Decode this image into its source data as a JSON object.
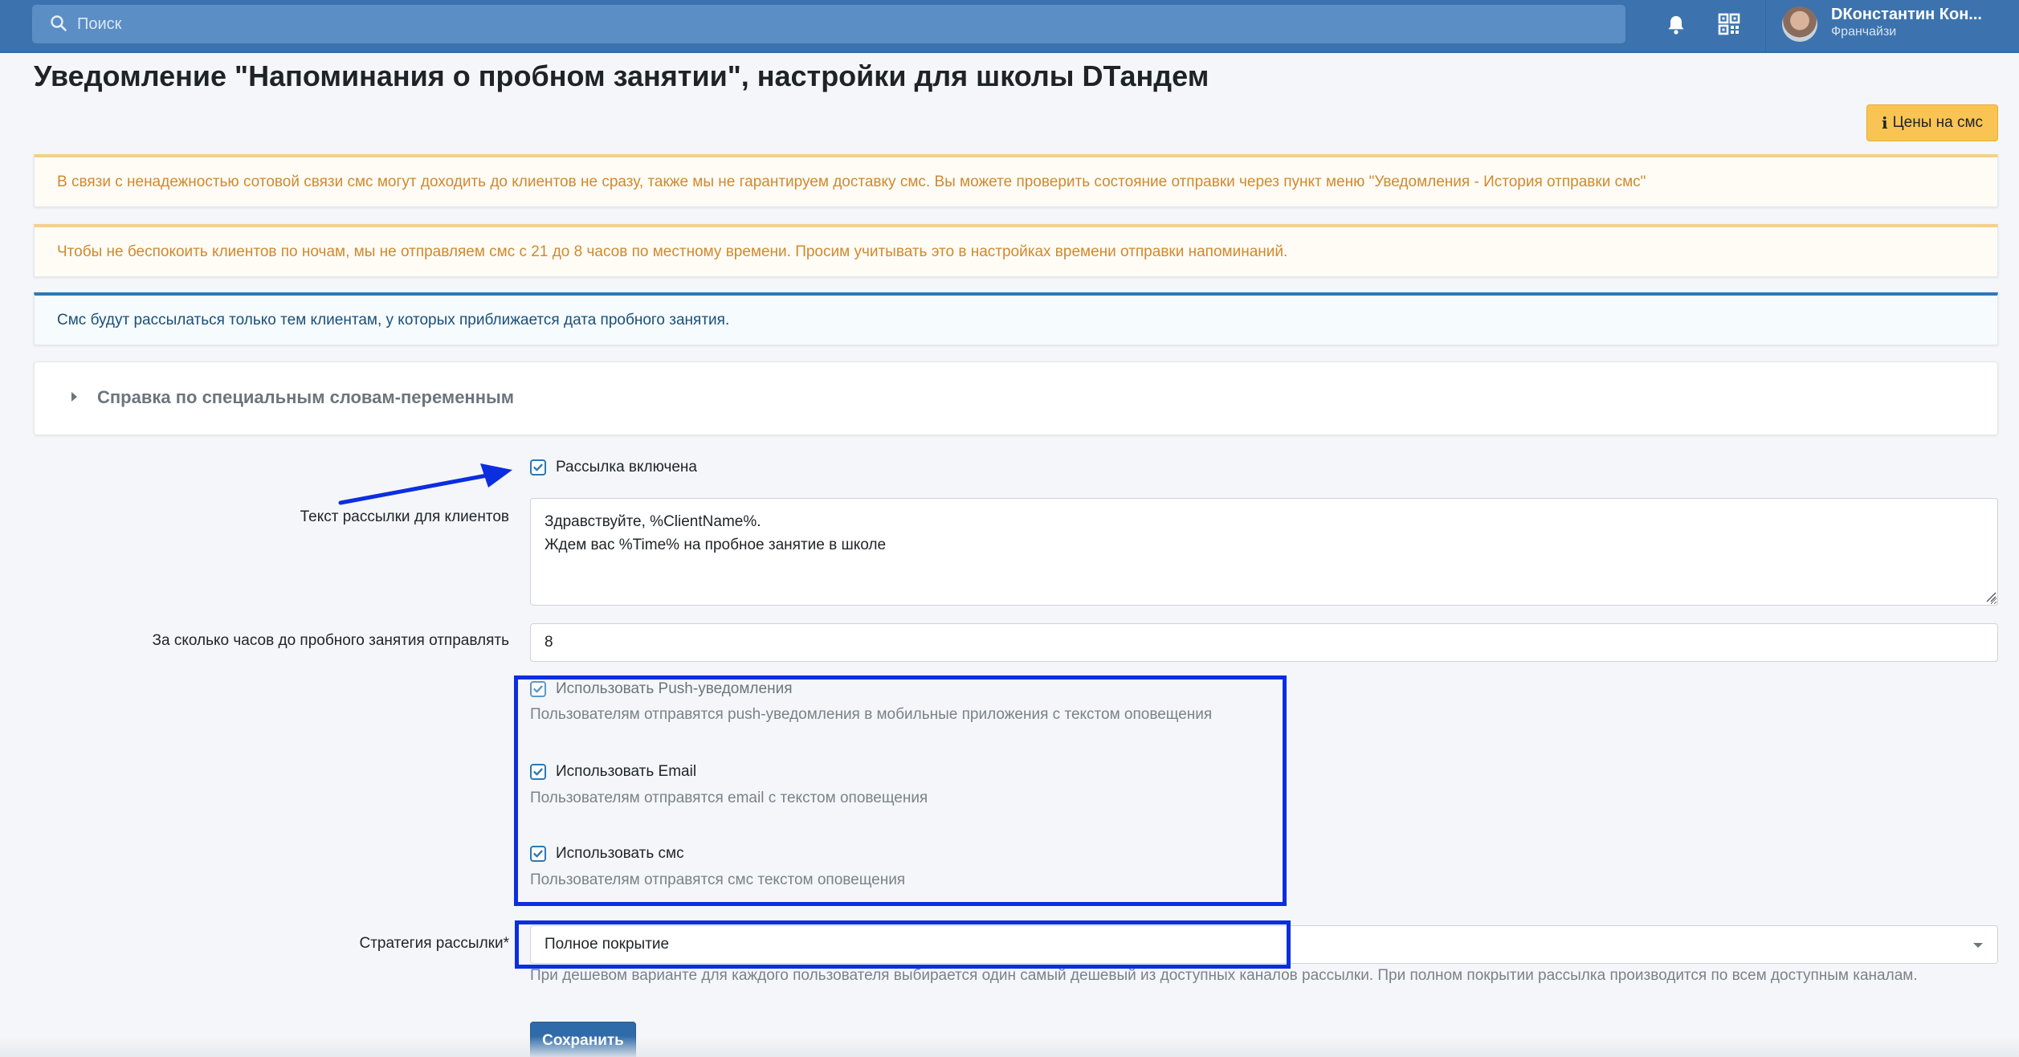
{
  "topbar": {
    "search_placeholder": "Поиск",
    "icons": [
      "search-icon",
      "bell-icon",
      "qr-code-icon"
    ],
    "user_name": "DКонстантин Кон...",
    "user_role": "Франчайзи"
  },
  "page": {
    "title": "Уведомление \"Напоминания о пробном занятии\", настройки для школы DТандем",
    "sms_price_button": "Цены на смс"
  },
  "alerts": [
    "В связи с ненадежностью сотовой связи смс могут доходить до клиентов не сразу, также мы не гарантируем доставку смс. Вы можете проверить состояние отправки через пункт меню \"Уведомления - История отправки смс\"",
    "Чтобы не беспокоить клиентов по ночам, мы не отправляем смс с 21 до 8 часов по местному времени. Просим учитывать это в настройках времени отправки напоминаний.",
    "Смс будут рассылаться только тем клиентам, у которых приближается дата пробного занятия."
  ],
  "help_section": {
    "label": "Справка по специальным словам-переменным",
    "expanded": false
  },
  "form": {
    "mailing_enabled": {
      "label": "Рассылка включена",
      "checked": true
    },
    "message_text": {
      "label": "Текст рассылки для клиентов",
      "value": "Здравствуйте, %ClientName%.\nЖдем вас %Time% на пробное занятие в школе"
    },
    "hours_before": {
      "label": "За сколько часов до пробного занятия отправлять",
      "value": "8"
    },
    "channels": [
      {
        "label": "Использовать Push-уведомления",
        "checked": true,
        "disabled": true,
        "help": "Пользователям отправятся push-уведомления в мобильные приложения с текстом оповещения"
      },
      {
        "label": "Использовать Email",
        "checked": true,
        "disabled": false,
        "help": "Пользователям отправятся email с текстом оповещения"
      },
      {
        "label": "Использовать смс",
        "checked": true,
        "disabled": false,
        "help": "Пользователям отправятся смс текстом оповещения"
      }
    ],
    "strategy": {
      "label": "Стратегия рассылки*",
      "value": "Полное покрытие",
      "help": "При дешевом варианте для каждого пользователя выбирается один самый дешевый из доступных каналов рассылки. При полном покрытии рассылка производится по всем доступным каналам."
    },
    "save_button": "Сохранить"
  },
  "colors": {
    "topbar": "#3c73ae",
    "annotation": "#0b2ee0",
    "warning_text": "#d0892d",
    "info_border": "#2d79b5",
    "primary_button": "#2f6ba8",
    "sms_price_button": "#f9c453"
  }
}
